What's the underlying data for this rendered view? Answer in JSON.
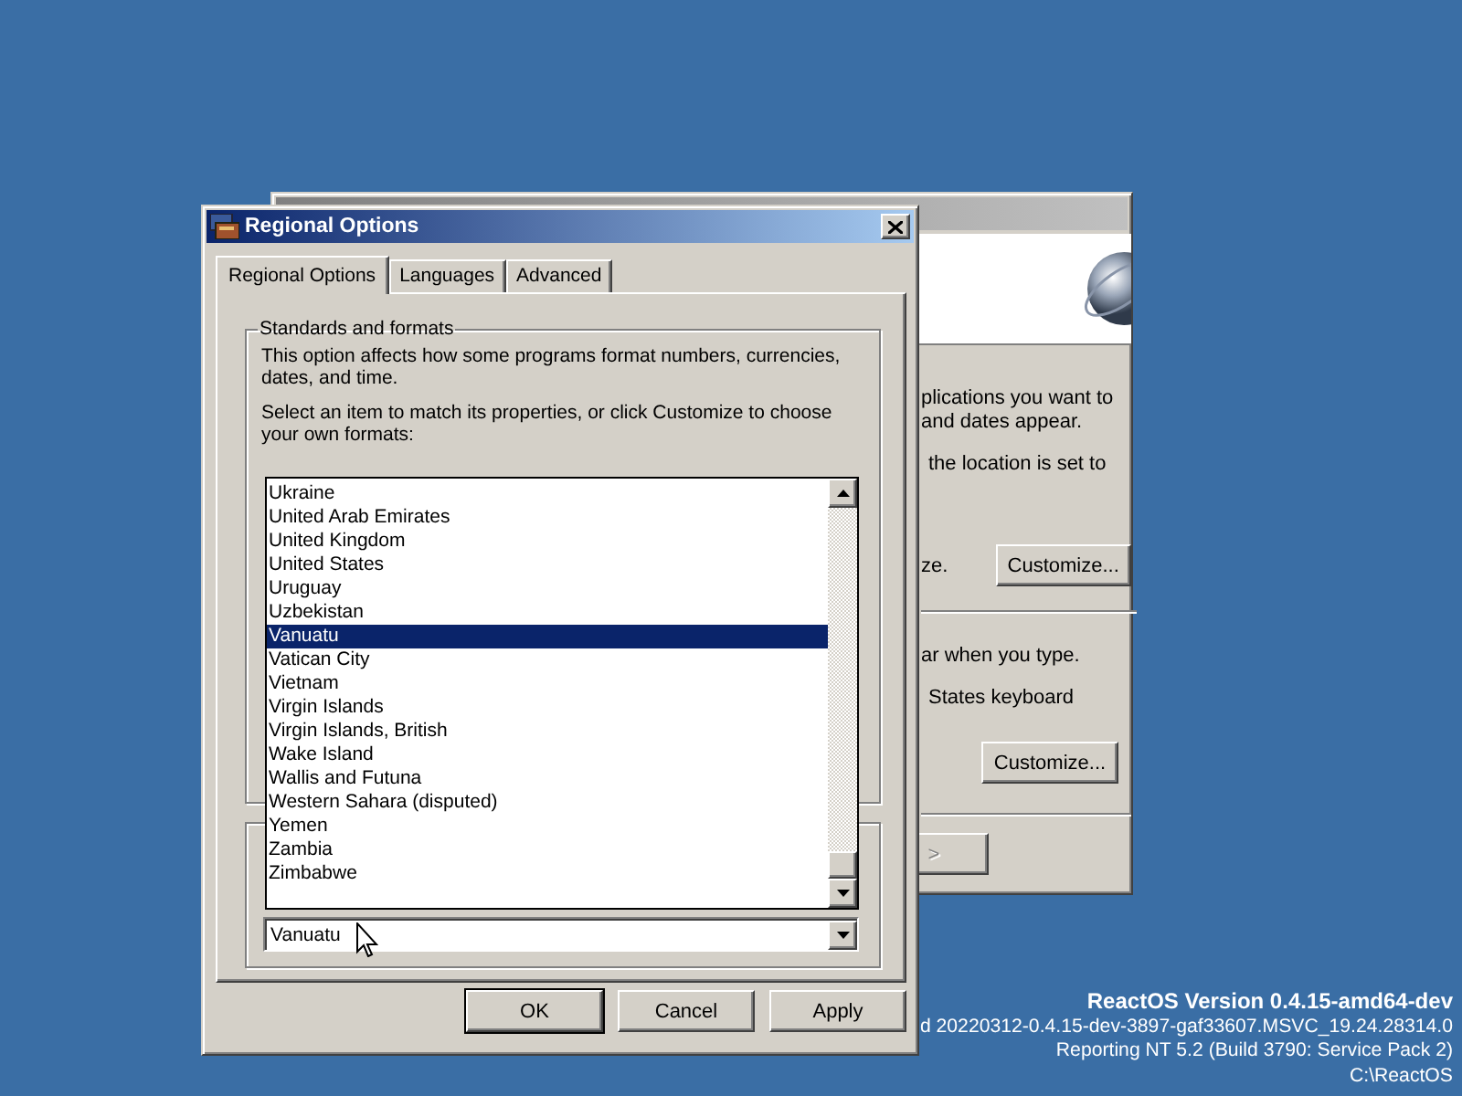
{
  "back_window": {
    "lines": [
      "plications you want to",
      "and dates appear.",
      "the location is set to"
    ],
    "first_button_note": "ze.",
    "first_button": "Customize...",
    "keyboard_lines": [
      "ar when you type.",
      "States keyboard"
    ],
    "second_button": "Customize...",
    "next_button": {
      "label": ">",
      "disabled": true
    }
  },
  "dialog": {
    "title": "Regional Options",
    "tabs": [
      {
        "label": "Regional Options",
        "selected": true
      },
      {
        "label": "Languages",
        "selected": false
      },
      {
        "label": "Advanced",
        "selected": false
      }
    ],
    "group": {
      "title": "Standards and formats",
      "description": "This option affects how some programs format numbers, currencies, dates, and time.",
      "instruction": "Select an item to match its properties, or click Customize to choose your own formats:"
    },
    "dropdown": {
      "items": [
        {
          "label": "Ukraine",
          "selected": false
        },
        {
          "label": "United Arab Emirates",
          "selected": false
        },
        {
          "label": "United Kingdom",
          "selected": false
        },
        {
          "label": "United States",
          "selected": false
        },
        {
          "label": "Uruguay",
          "selected": false
        },
        {
          "label": "Uzbekistan",
          "selected": false
        },
        {
          "label": "Vanuatu",
          "selected": true
        },
        {
          "label": "Vatican City",
          "selected": false
        },
        {
          "label": "Vietnam",
          "selected": false
        },
        {
          "label": "Virgin Islands",
          "selected": false
        },
        {
          "label": "Virgin Islands, British",
          "selected": false
        },
        {
          "label": "Wake Island",
          "selected": false
        },
        {
          "label": "Wallis and Futuna",
          "selected": false
        },
        {
          "label": "Western Sahara (disputed)",
          "selected": false
        },
        {
          "label": "Yemen",
          "selected": false
        },
        {
          "label": "Zambia",
          "selected": false
        },
        {
          "label": "Zimbabwe",
          "selected": false
        }
      ]
    },
    "location_combo": {
      "value": "Vanuatu"
    },
    "buttons": [
      "OK",
      "Cancel",
      "Apply"
    ]
  },
  "version_info": {
    "lines": [
      "ReactOS Version 0.4.15-amd64-dev",
      "d 20220312-0.4.15-dev-3897-gaf33607.MSVC_19.24.28314.0",
      "Reporting NT 5.2 (Build 3790: Service Pack 2)",
      "C:\\ReactOS"
    ]
  }
}
